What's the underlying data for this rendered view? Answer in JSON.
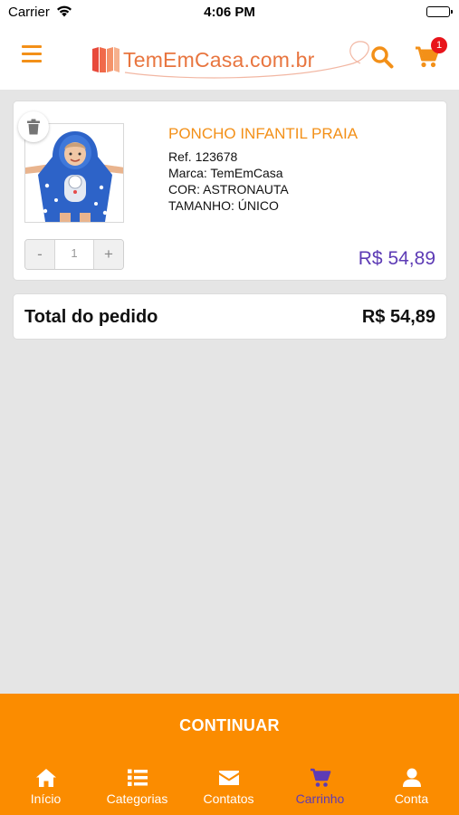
{
  "status_bar": {
    "carrier": "Carrier",
    "time": "4:06 PM"
  },
  "header": {
    "logo_text": "TemEmCasa.com.br",
    "cart_count": "1",
    "icons": [
      "menu-icon",
      "search-icon",
      "cart-icon"
    ]
  },
  "cart": {
    "item": {
      "name": "PONCHO INFANTIL PRAIA",
      "ref": "Ref. 123678",
      "brand": "Marca: TemEmCasa",
      "color": "COR: ASTRONAUTA",
      "size": "TAMANHO: ÚNICO",
      "qty_minus": "-",
      "qty_value": "1",
      "qty_plus": "+",
      "price": "R$ 54,89"
    },
    "total_label": "Total do pedido",
    "total_value": "R$ 54,89",
    "continue_label": "CONTINUAR"
  },
  "tabs": [
    {
      "label": "Início",
      "icon": "home-icon",
      "active": false
    },
    {
      "label": "Categorias",
      "icon": "list-icon",
      "active": false
    },
    {
      "label": "Contatos",
      "icon": "envelope-icon",
      "active": false
    },
    {
      "label": "Carrinho",
      "icon": "cart-icon",
      "active": true
    },
    {
      "label": "Conta",
      "icon": "user-icon",
      "active": false
    }
  ],
  "colors": {
    "accent_orange": "#fb8c00",
    "title_orange": "#f39018",
    "price_purple": "#5d3bb5",
    "badge_red": "#e8141b",
    "background": "#e5e5e5"
  }
}
